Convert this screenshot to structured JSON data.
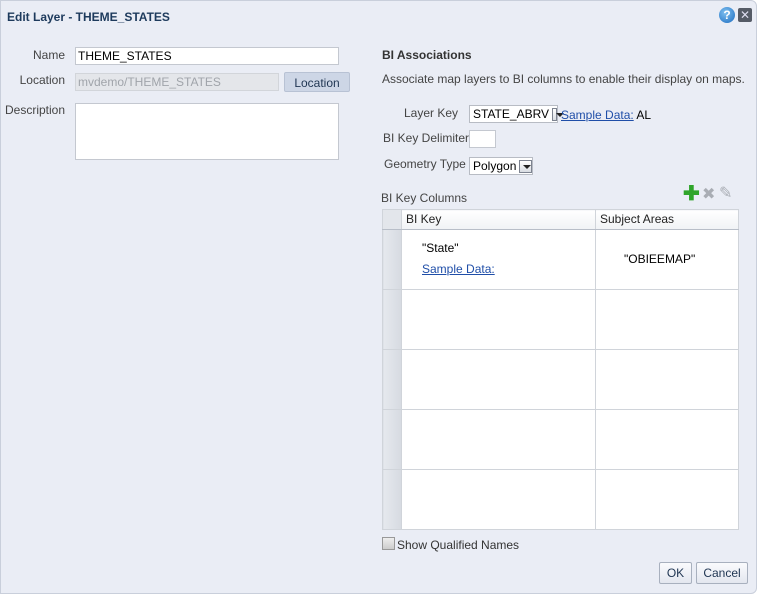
{
  "dialog": {
    "title": "Edit Layer - THEME_STATES"
  },
  "left": {
    "name_label": "Name",
    "name_value": "THEME_STATES",
    "location_label": "Location",
    "location_value": "mvdemo/THEME_STATES",
    "location_button": "Location",
    "description_label": "Description",
    "description_value": ""
  },
  "bi": {
    "heading": "BI Associations",
    "intro": "Associate map layers to BI columns to enable their display on maps.",
    "layer_key_label": "Layer Key",
    "layer_key_value": "STATE_ABRV",
    "sample_data_link": "Sample Data:",
    "sample_data_value": "AL",
    "delimiter_label": "BI Key Delimiter",
    "delimiter_value": "",
    "geometry_label": "Geometry Type",
    "geometry_value": "Polygon",
    "columns_label": "BI Key Columns",
    "table": {
      "headers": [
        "BI Key",
        "Subject Areas"
      ],
      "rows": [
        {
          "bi_key": "\"State\"",
          "sample_link": "Sample Data:",
          "subject_area": "\"OBIEEMAP\""
        }
      ]
    },
    "show_qualified_label": "Show Qualified Names",
    "show_qualified_checked": false
  },
  "footer": {
    "ok": "OK",
    "cancel": "Cancel"
  },
  "icons": [
    "help-icon",
    "close-icon",
    "add-icon",
    "delete-icon",
    "edit-icon"
  ]
}
